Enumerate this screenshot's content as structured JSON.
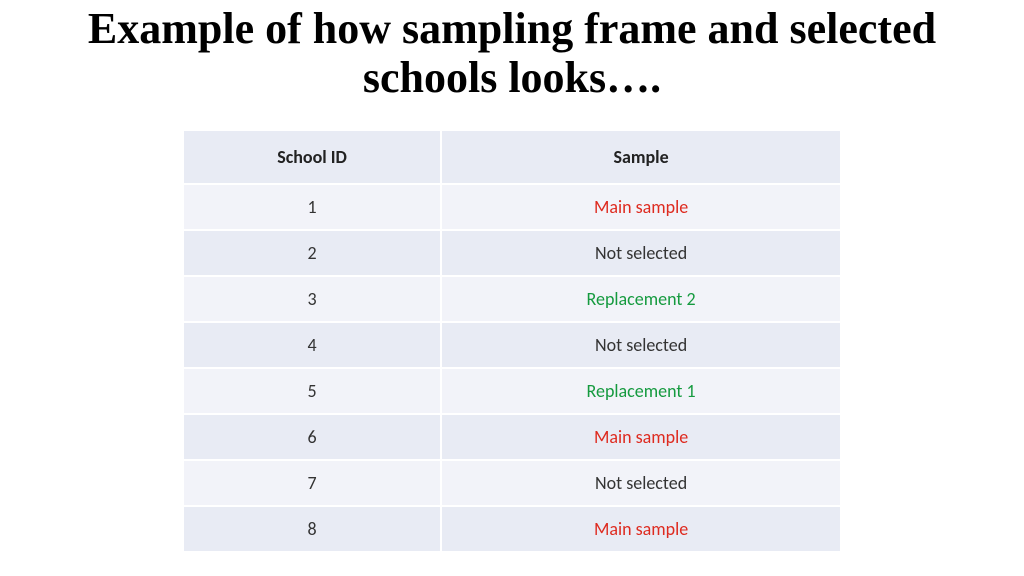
{
  "title": "Example of how sampling frame and selected schools looks….",
  "headers": {
    "col1": "School ID",
    "col2": "Sample"
  },
  "status_labels": {
    "main": "Main sample",
    "not_selected": "Not selected",
    "replacement1": "Replacement 1",
    "replacement2": "Replacement 2"
  },
  "rows": [
    {
      "id": "1",
      "status": "main"
    },
    {
      "id": "2",
      "status": "not_selected"
    },
    {
      "id": "3",
      "status": "replacement2"
    },
    {
      "id": "4",
      "status": "not_selected"
    },
    {
      "id": "5",
      "status": "replacement1"
    },
    {
      "id": "6",
      "status": "main"
    },
    {
      "id": "7",
      "status": "not_selected"
    },
    {
      "id": "8",
      "status": "main"
    }
  ],
  "chart_data": {
    "type": "table",
    "title": "Example of how sampling frame and selected schools looks….",
    "columns": [
      "School ID",
      "Sample"
    ],
    "rows": [
      [
        "1",
        "Main sample"
      ],
      [
        "2",
        "Not selected"
      ],
      [
        "3",
        "Replacement 2"
      ],
      [
        "4",
        "Not selected"
      ],
      [
        "5",
        "Replacement 1"
      ],
      [
        "6",
        "Main sample"
      ],
      [
        "7",
        "Not selected"
      ],
      [
        "8",
        "Main sample"
      ]
    ]
  }
}
